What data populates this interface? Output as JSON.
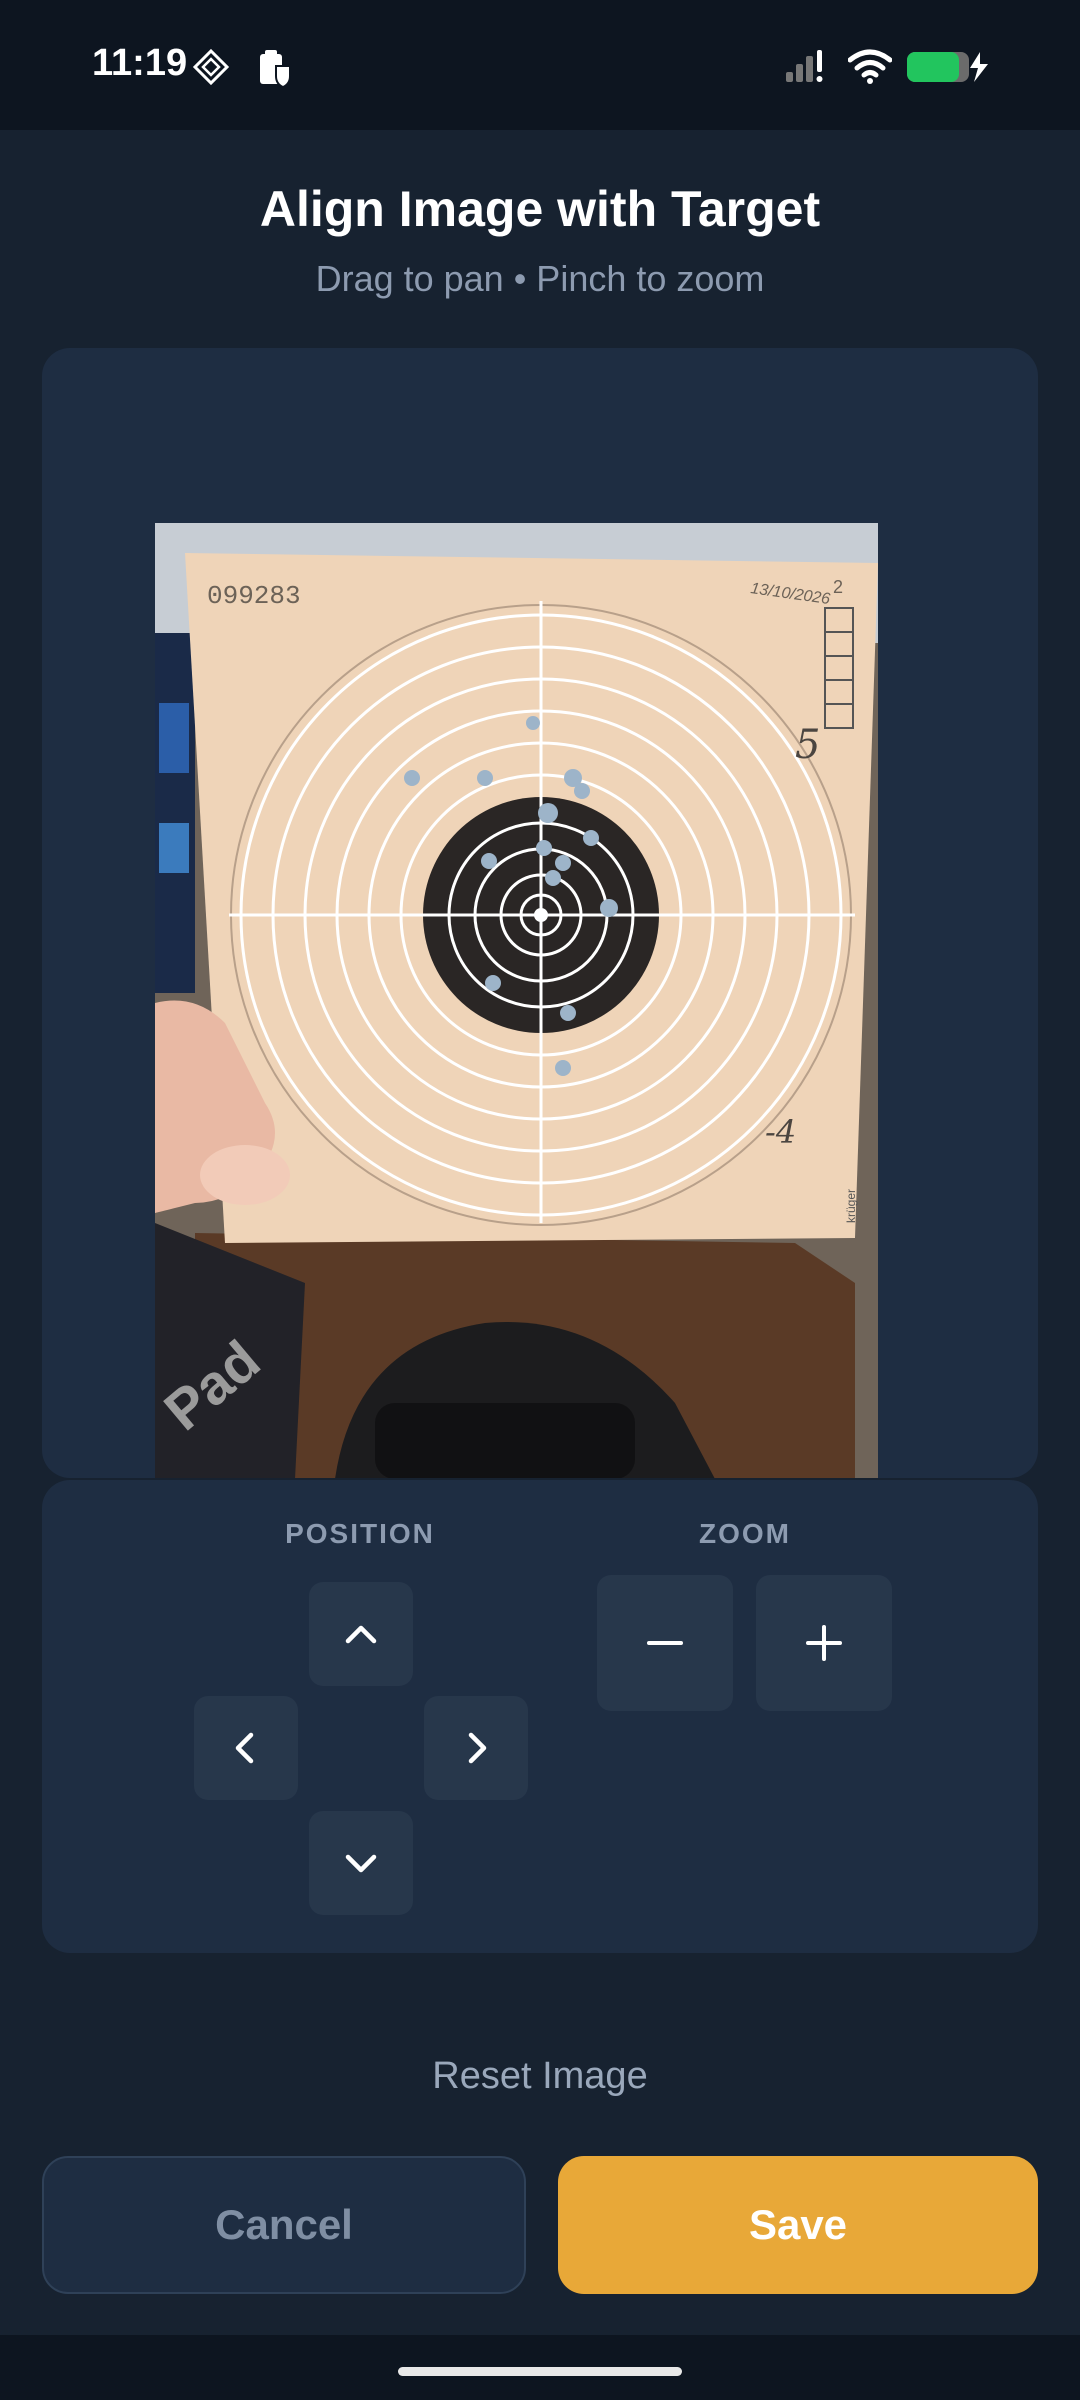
{
  "status_bar": {
    "time": "11:19",
    "icons": [
      "app-diamond-icon",
      "clipboard-shield-icon",
      "cellular-signal-icon",
      "wifi-icon",
      "battery-charging-icon"
    ],
    "battery_color": "#22c55e"
  },
  "header": {
    "title": "Align Image with Target",
    "subtitle": "Drag to pan • Pinch to zoom"
  },
  "photo": {
    "serial": "099283",
    "date": "13/10/2026",
    "corner_number": "2",
    "note_top": "5",
    "note_bottom": "-4",
    "brand": "krüger",
    "background_text": "Pad"
  },
  "controls": {
    "position_label": "POSITION",
    "zoom_label": "ZOOM"
  },
  "actions": {
    "reset_label": "Reset Image",
    "cancel_label": "Cancel",
    "save_label": "Save"
  },
  "colors": {
    "accent": "#e8a838",
    "card": "#1e2d42",
    "background": "#172230"
  }
}
